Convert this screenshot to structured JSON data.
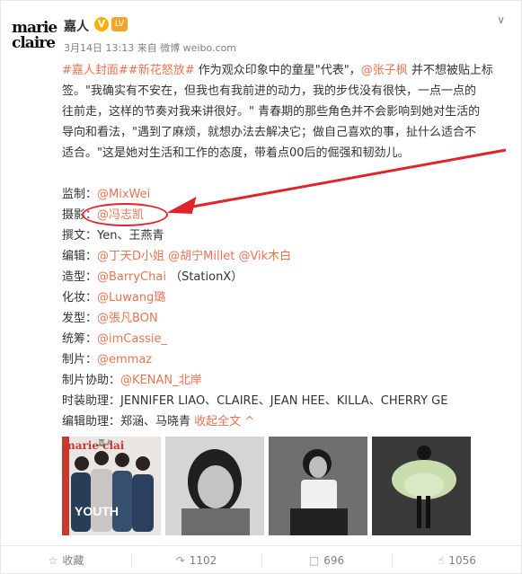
{
  "header": {
    "logo_line1": "marie",
    "logo_line2": "claire",
    "username": "嘉人",
    "verified": "V",
    "level": "LV",
    "meta": "3月14日 13:13 来自 微博 weibo.com",
    "more_icon": "chevron-down-icon"
  },
  "post": {
    "hashtag1": "#嘉人封面#",
    "hashtag2": "#新花怒放#",
    "intro": " 作为观众印象中的童星\"代表\"，",
    "mention_main": "@张子枫",
    "line1_tail": " 并不想被贴上标",
    "line2": "签。\"我确实有不安在，但我也有我前进的动力，我的步伐没有很快，一点一点的",
    "line3": "往前走，这样的节奏对我来讲很好。\" 青春期的那些角色并不会影响到她对生活的",
    "line4": "导向和看法，\"遇到了麻烦，就想办法去解决它；做自己喜欢的事，扯什么适合不",
    "line5": "适合。\"这是她对生活和工作的态度，带着点00后的倔强和韧劲儿。"
  },
  "credits": [
    {
      "label": "监制：",
      "value": "@MixWei",
      "value_style": "link"
    },
    {
      "label": "摄影：",
      "value": "@冯志凯",
      "value_style": "link"
    },
    {
      "label": "撰文：",
      "value": "Yen、王燕青",
      "value_style": "text"
    },
    {
      "label": "编辑：",
      "value": "@丁天D小姐 @胡宁Millet @Vik木白",
      "value_style": "link"
    },
    {
      "label": "造型：",
      "value": "@BarryChai",
      "value_extra": " （StationX）",
      "value_style": "link"
    },
    {
      "label": "化妆：",
      "value": "@Luwang璐",
      "value_style": "link"
    },
    {
      "label": "发型：",
      "value": "@張凡BON",
      "value_style": "link"
    },
    {
      "label": "统筹：",
      "value": "@imCassie_",
      "value_style": "link"
    },
    {
      "label": "制片：",
      "value": "@emmaz",
      "value_style": "link"
    },
    {
      "label": "制片协助：",
      "value": "@KENAN_北岸",
      "value_style": "link"
    },
    {
      "label": "时装助理：",
      "value": "JENNIFER LIAO、CLAIRE、JEAN HEE、KILLA、CHERRY GE",
      "value_style": "text"
    },
    {
      "label": "编辑助理：",
      "value": "郑涵、马晓青",
      "value_style": "text",
      "collapse": "收起全文 ^"
    }
  ],
  "photos": {
    "cover_logo": "marie clai",
    "cover_tag": "嘉人",
    "cover_text": "YOUTH"
  },
  "actions": {
    "favorite_icon": "star-icon",
    "favorite_label": "收藏",
    "share_icon": "share-icon",
    "share_count": "1102",
    "comment_icon": "comment-icon",
    "comment_count": "696",
    "like_icon": "thumbs-up-icon",
    "like_count": "1056"
  },
  "colors": {
    "link": "#eb7350",
    "annotation": "#e0242b",
    "verified": "#fab000"
  }
}
